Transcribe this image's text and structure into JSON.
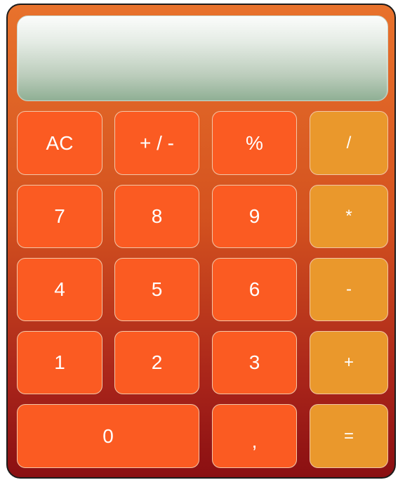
{
  "display": {
    "value": ""
  },
  "keys": {
    "ac": "AC",
    "sign": "+ / -",
    "percent": "%",
    "divide": "/",
    "seven": "7",
    "eight": "8",
    "nine": "9",
    "multiply": "*",
    "four": "4",
    "five": "5",
    "six": "6",
    "subtract": "-",
    "one": "1",
    "two": "2",
    "three": "3",
    "add": "+",
    "zero": "0",
    "comma": ",",
    "equals": "="
  },
  "colors": {
    "digit_key": "#fb5b22",
    "operator_key": "#ea982c",
    "body_top": "#e8722c",
    "body_bottom": "#8a0f12",
    "display_top": "#fbfcfb",
    "display_bottom": "#8faf94"
  }
}
